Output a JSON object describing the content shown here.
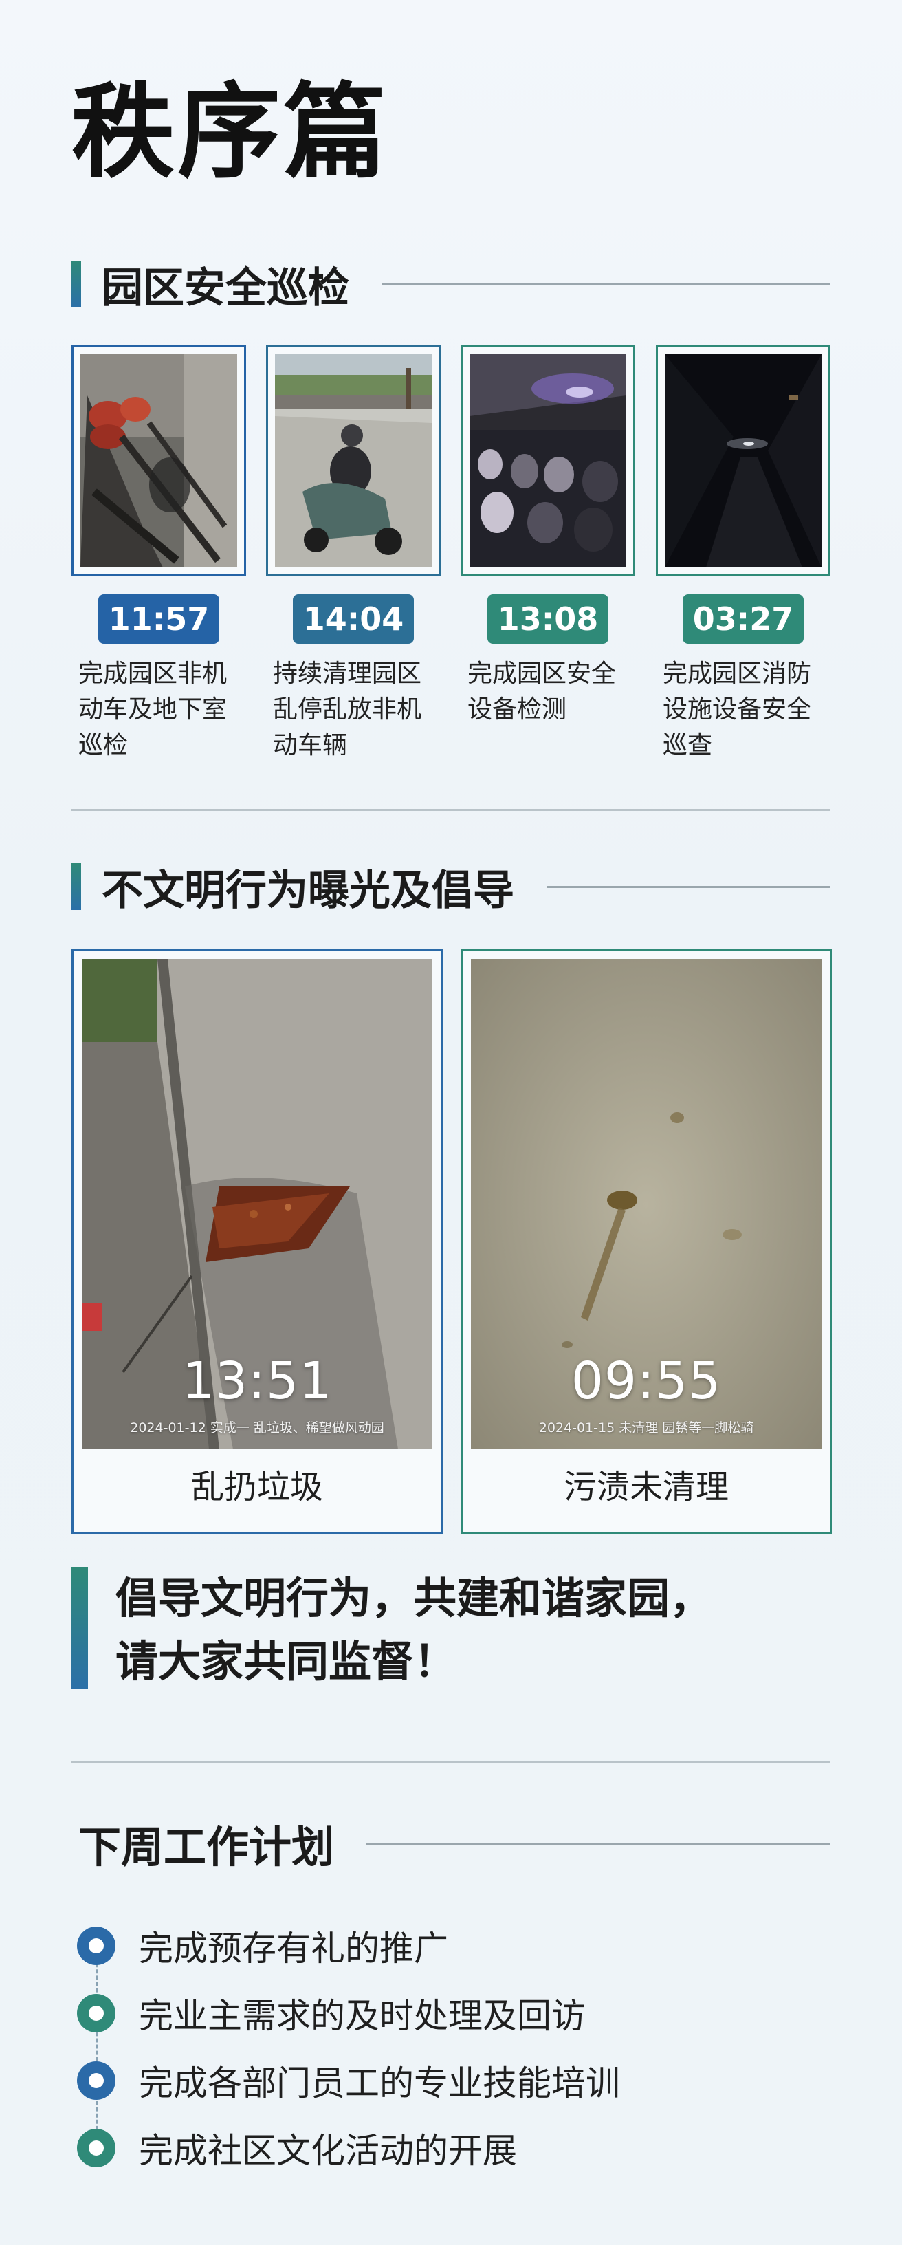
{
  "page_title": "秩序篇",
  "colors": {
    "blue": "#2b6aa8",
    "teal": "#2f8a78",
    "rule": "#9aa6ad"
  },
  "section_patrol": {
    "title": "园区安全巡检",
    "cards": [
      {
        "time": "11:57",
        "desc": "完成园区非机动车及地下室巡检",
        "accent": "#2563a6",
        "image": "bike-parking-photo"
      },
      {
        "time": "14:04",
        "desc": "持续清理园区乱停乱放非机动车辆",
        "accent": "#2c6f96",
        "image": "scooter-rider-photo"
      },
      {
        "time": "13:08",
        "desc": "完成园区安全设备检测",
        "accent": "#2f8a78",
        "image": "parking-garage-photo"
      },
      {
        "time": "03:27",
        "desc": "完成园区消防设施设备安全巡查",
        "accent": "#2f8a78",
        "image": "night-corridor-photo"
      }
    ]
  },
  "section_incivility": {
    "title": "不文明行为曝光及倡导",
    "cards": [
      {
        "label": "乱扔垃圾",
        "stamp_time": "13:51",
        "stamp_sub": "2024-01-12 实成一  乱垃圾、稀望做风动园",
        "accent": "#2b6aa8"
      },
      {
        "label": "污渍未清理",
        "stamp_time": "09:55",
        "stamp_sub": "2024-01-15 未清理  园锈等一脚松骑",
        "accent": "#2f8a78"
      }
    ]
  },
  "slogan": {
    "line1": "倡导文明行为，共建和谐家园，",
    "line2": "请大家共同监督！"
  },
  "plan": {
    "title": "下周工作计划",
    "items": [
      {
        "text": "完成预存有礼的推广",
        "color": "#2b6aa8"
      },
      {
        "text": "完业主需求的及时处理及回访",
        "color": "#2f8a78"
      },
      {
        "text": "完成各部门员工的专业技能培训",
        "color": "#2b6aa8"
      },
      {
        "text": "完成社区文化活动的开展",
        "color": "#2f8a78"
      }
    ]
  }
}
